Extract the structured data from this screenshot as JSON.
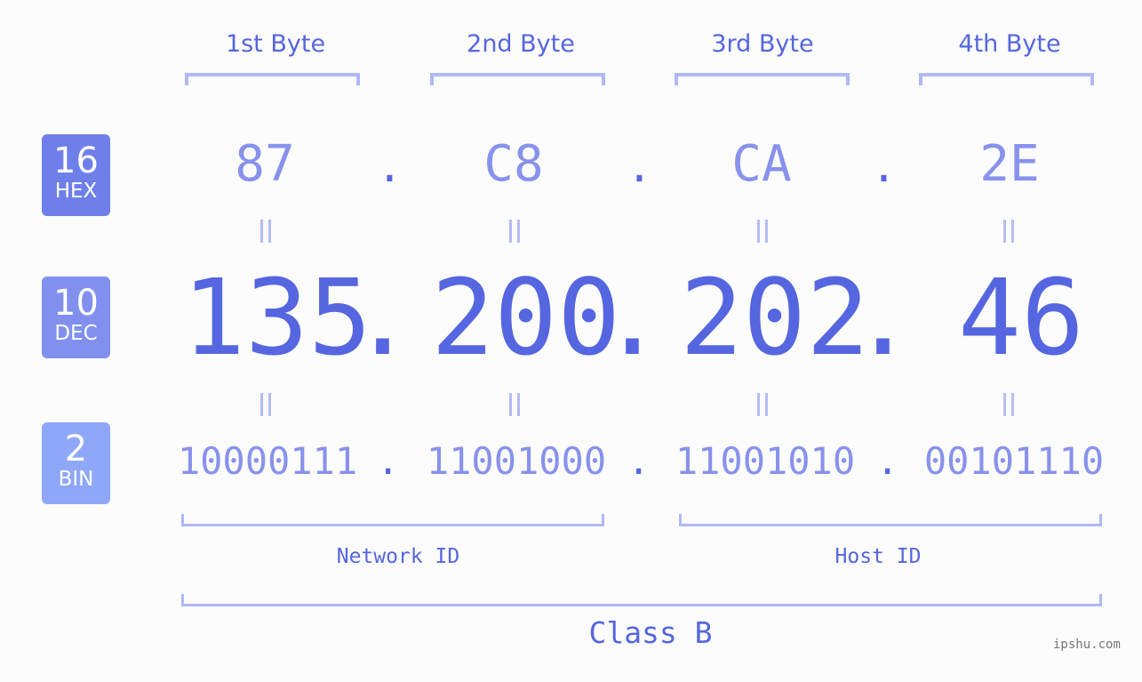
{
  "bytes": {
    "headers": [
      "1st Byte",
      "2nd Byte",
      "3rd Byte",
      "4th Byte"
    ],
    "hex": [
      "87",
      "C8",
      "CA",
      "2E"
    ],
    "dec": [
      "135",
      "200",
      "202",
      "46"
    ],
    "bin": [
      "10000111",
      "11001000",
      "11001010",
      "00101110"
    ],
    "separator": "."
  },
  "badges": {
    "hex": {
      "num": "16",
      "label": "HEX",
      "color": "#6f7fe9"
    },
    "dec": {
      "num": "10",
      "label": "DEC",
      "color": "#8190ef"
    },
    "bin": {
      "num": "2",
      "label": "BIN",
      "color": "#8ea7f9"
    }
  },
  "groups": {
    "network": "Network ID",
    "host": "Host ID",
    "class": "Class B"
  },
  "watermark": "ipshu.com"
}
